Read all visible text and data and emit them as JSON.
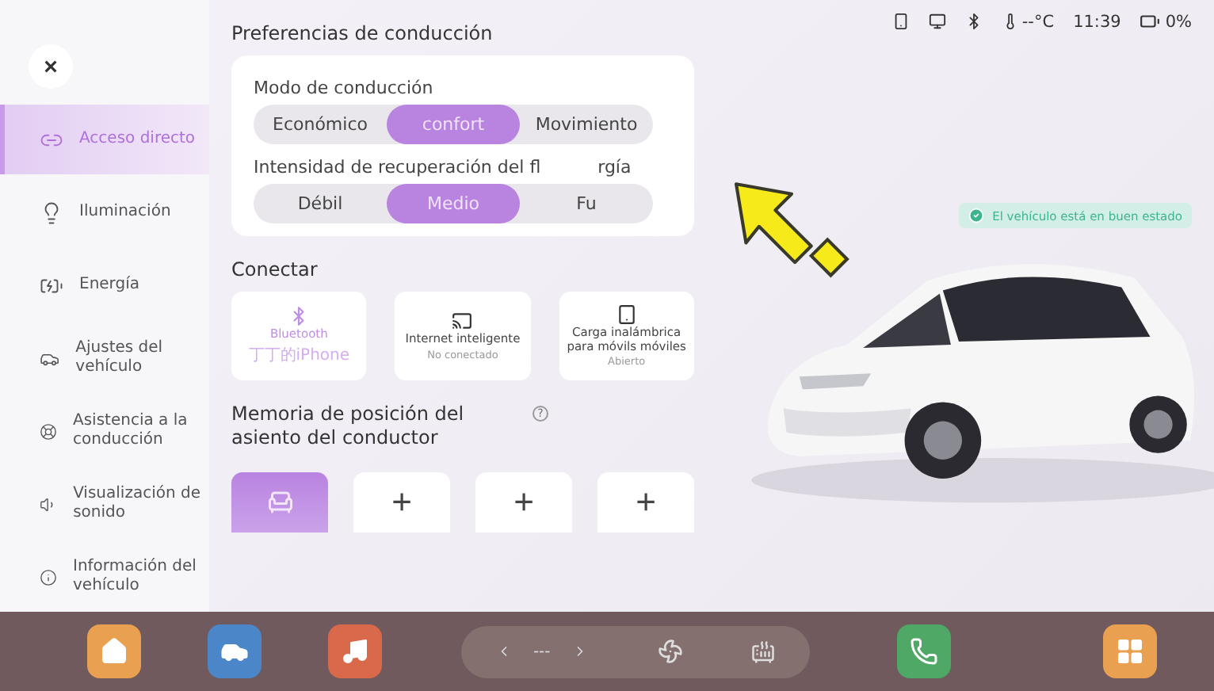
{
  "sidebar": {
    "close": "×",
    "items": [
      {
        "label": "Acceso directo",
        "selected": true
      },
      {
        "label": "Iluminación",
        "selected": false
      },
      {
        "label": "Energía",
        "selected": false
      },
      {
        "label": "Ajustes del vehículo",
        "selected": false
      },
      {
        "label": "Asistencia a la conducción",
        "selected": false
      },
      {
        "label": "Visualización de sonido",
        "selected": false
      },
      {
        "label": "Información del vehículo",
        "selected": false
      }
    ]
  },
  "driving": {
    "title": "Preferencias de conducción",
    "groups": [
      {
        "label_parts": [
          "Modo de conducción"
        ],
        "options": [
          {
            "label": "Económico",
            "selected": false
          },
          {
            "label": "confort",
            "selected": true
          },
          {
            "label": "Movimiento",
            "selected": false
          }
        ]
      },
      {
        "label_parts": [
          "Intensidad de recuperación del fl",
          "rgía"
        ],
        "options": [
          {
            "label": "Débil",
            "selected": false
          },
          {
            "label": "Medio",
            "selected": true
          },
          {
            "label": "Fu",
            "selected": false
          }
        ]
      }
    ]
  },
  "connect": {
    "title": "Conectar",
    "tiles": [
      {
        "title": "Bluetooth",
        "subtitle": "丁丁的iPhone",
        "on": true
      },
      {
        "title": "Internet inteligente",
        "subtitle": "No conectado",
        "on": false
      },
      {
        "title": "Carga inalámbrica para móvils móviles",
        "subtitle": "Abierto",
        "on": false
      }
    ]
  },
  "seat_memory": {
    "title": "Memoria de posición del asiento del conductor",
    "info": "?",
    "slots": [
      {
        "kind": "seat",
        "selected": true
      },
      {
        "kind": "add",
        "label": "+",
        "selected": false
      },
      {
        "kind": "add",
        "label": "+",
        "selected": false
      },
      {
        "kind": "add",
        "label": "+",
        "selected": false
      }
    ]
  },
  "status_bar": {
    "temperature": "--°C",
    "time": "11:39",
    "battery": "0%"
  },
  "vehicle_status": "El vehículo está en buen estado",
  "dock": {
    "apps": [
      {
        "kind": "home",
        "color": "#e9a050"
      },
      {
        "kind": "car",
        "color": "#4b86c8"
      },
      {
        "kind": "music",
        "color": "#d8694a"
      },
      {
        "kind": "phone",
        "color": "#4fa865"
      },
      {
        "kind": "apps",
        "color": "#e9a050"
      }
    ],
    "climate": {
      "temperature": "---"
    }
  }
}
